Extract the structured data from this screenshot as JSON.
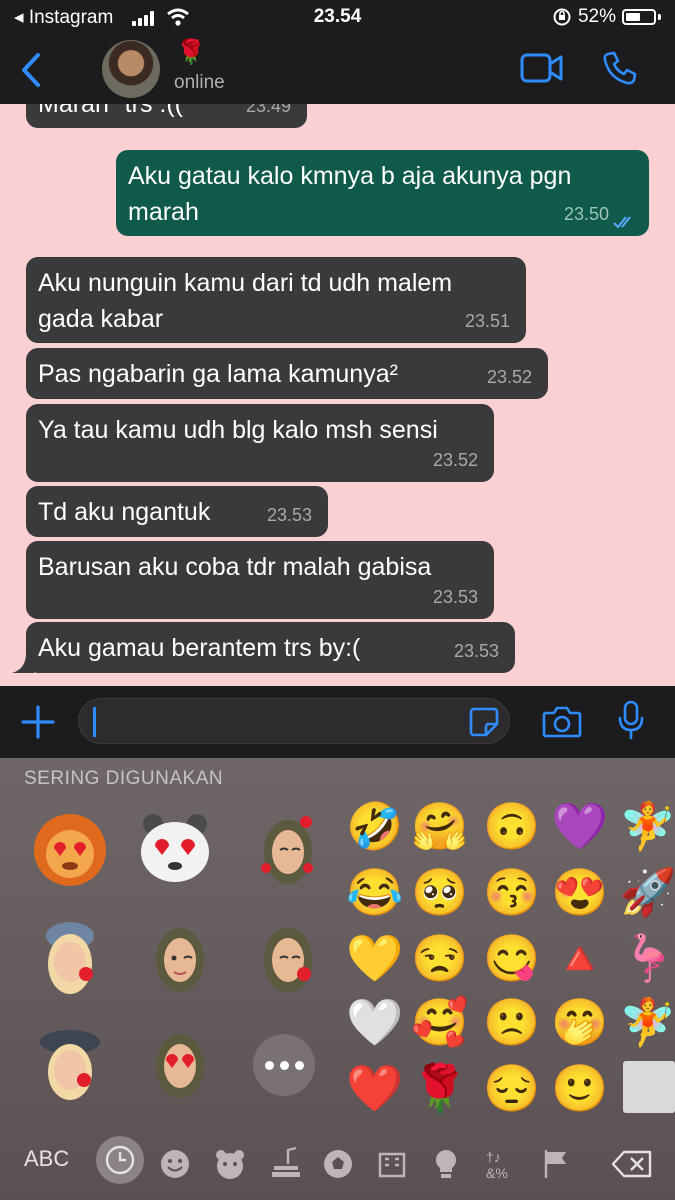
{
  "status_bar": {
    "back_app": "◂ Instagram",
    "time": "23.54",
    "battery": "52%",
    "battery_level": 0.52
  },
  "header": {
    "contact_name": "🌹",
    "contact_status": "online"
  },
  "messages": [
    {
      "direction": "in",
      "text": "Marah\" trs :((",
      "time": "23.49"
    },
    {
      "direction": "out",
      "text": "Aku gatau kalo kmnya b aja akunya pgn marah",
      "time": "23.50",
      "read": true
    },
    {
      "direction": "in",
      "text": "Aku nunguin kamu dari td udh malem gada kabar",
      "time": "23.51"
    },
    {
      "direction": "in",
      "text": "Pas ngabarin ga lama kamunya²",
      "time": "23.52"
    },
    {
      "direction": "in",
      "text": "Ya tau kamu udh blg kalo msh sensi",
      "time": "23.52"
    },
    {
      "direction": "in",
      "text": "Td aku ngantuk",
      "time": "23.53"
    },
    {
      "direction": "in",
      "text": "Barusan aku coba tdr malah gabisa",
      "time": "23.53"
    },
    {
      "direction": "in",
      "text": "Aku gamau berantem trs by:(",
      "time": "23.53"
    }
  ],
  "input": {
    "placeholder": ""
  },
  "keyboard": {
    "section_title": "SERING DIGUNAKAN",
    "abc_label": "ABC",
    "emoji_grid": [
      [
        "🤣",
        "🤗",
        "🙃",
        "💜",
        "🧚"
      ],
      [
        "😂",
        "🥺",
        "😚",
        "😍",
        "🚀"
      ],
      [
        "💛",
        "😒",
        "😋",
        "🔺",
        "🦩"
      ],
      [
        "🤍",
        "🥰",
        "🙁",
        "🤭",
        "🧚"
      ],
      [
        "❤️",
        "🌹",
        "😔",
        "🙂",
        ""
      ]
    ],
    "memoji": [
      "lion-heart-eyes",
      "panda-heart-eyes",
      "hijab-kiss-hearts",
      "blonde-wink-kiss",
      "hijab-wink",
      "hijab-kiss",
      "beret-kiss",
      "hijab-heart-eyes"
    ]
  },
  "colors": {
    "chat_bg": "#fbd0d3",
    "incoming": "#3a3a3c",
    "outgoing": "#0f5a4a",
    "accent": "#2f8cff"
  }
}
